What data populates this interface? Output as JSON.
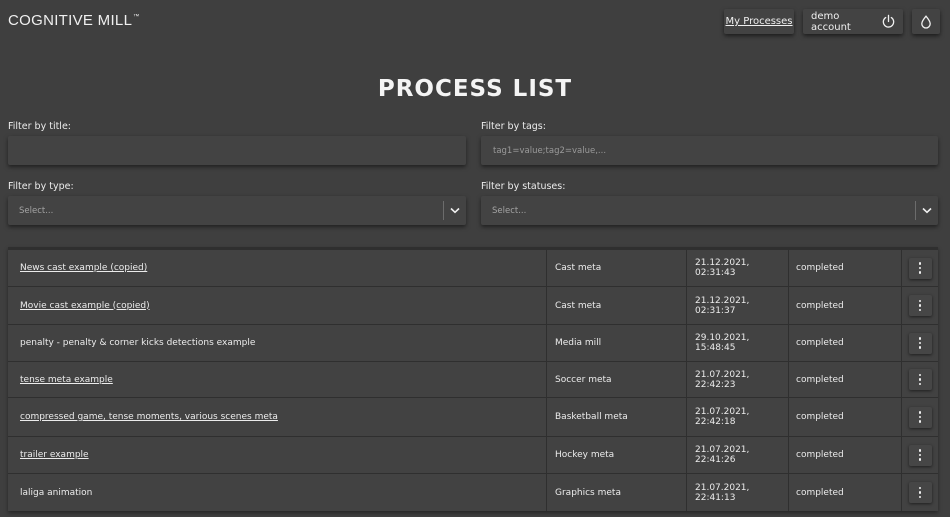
{
  "header": {
    "logo": "COGNITIVE MILL",
    "logo_tm": "™",
    "my_processes": "My Processes",
    "account": "demo account",
    "power_icon": "power-icon",
    "theme_icon": "droplet-icon"
  },
  "page_title": "PROCESS LIST",
  "filters": {
    "title_label": "Filter by title:",
    "title_value": "",
    "tags_label": "Filter by tags:",
    "tags_placeholder": "tag1=value;tag2=value,...",
    "type_label": "Filter by type:",
    "type_selected": "Select...",
    "status_label": "Filter by statuses:",
    "status_selected": "Select..."
  },
  "processes": [
    {
      "title": "News cast example (copied)",
      "link": true,
      "type": "Cast meta",
      "date": "21.12.2021, 02:31:43",
      "status": "completed"
    },
    {
      "title": "Movie cast example (copied)",
      "link": true,
      "type": "Cast meta",
      "date": "21.12.2021, 02:31:37",
      "status": "completed"
    },
    {
      "title": "penalty - penalty & corner kicks detections example",
      "link": false,
      "type": "Media mill",
      "date": "29.10.2021, 15:48:45",
      "status": "completed"
    },
    {
      "title": "tense meta example",
      "link": true,
      "type": "Soccer meta",
      "date": "21.07.2021, 22:42:23",
      "status": "completed"
    },
    {
      "title": "compressed game, tense moments, various scenes meta",
      "link": true,
      "type": "Basketball meta",
      "date": "21.07.2021, 22:42:18",
      "status": "completed"
    },
    {
      "title": "trailer example",
      "link": true,
      "type": "Hockey meta",
      "date": "21.07.2021, 22:41:26",
      "status": "completed"
    },
    {
      "title": "laliga animation",
      "link": false,
      "type": "Graphics meta",
      "date": "21.07.2021, 22:41:13",
      "status": "completed"
    }
  ],
  "colors": {
    "background": "#3f3f3f",
    "surface": "#434343",
    "text": "#ececec"
  }
}
